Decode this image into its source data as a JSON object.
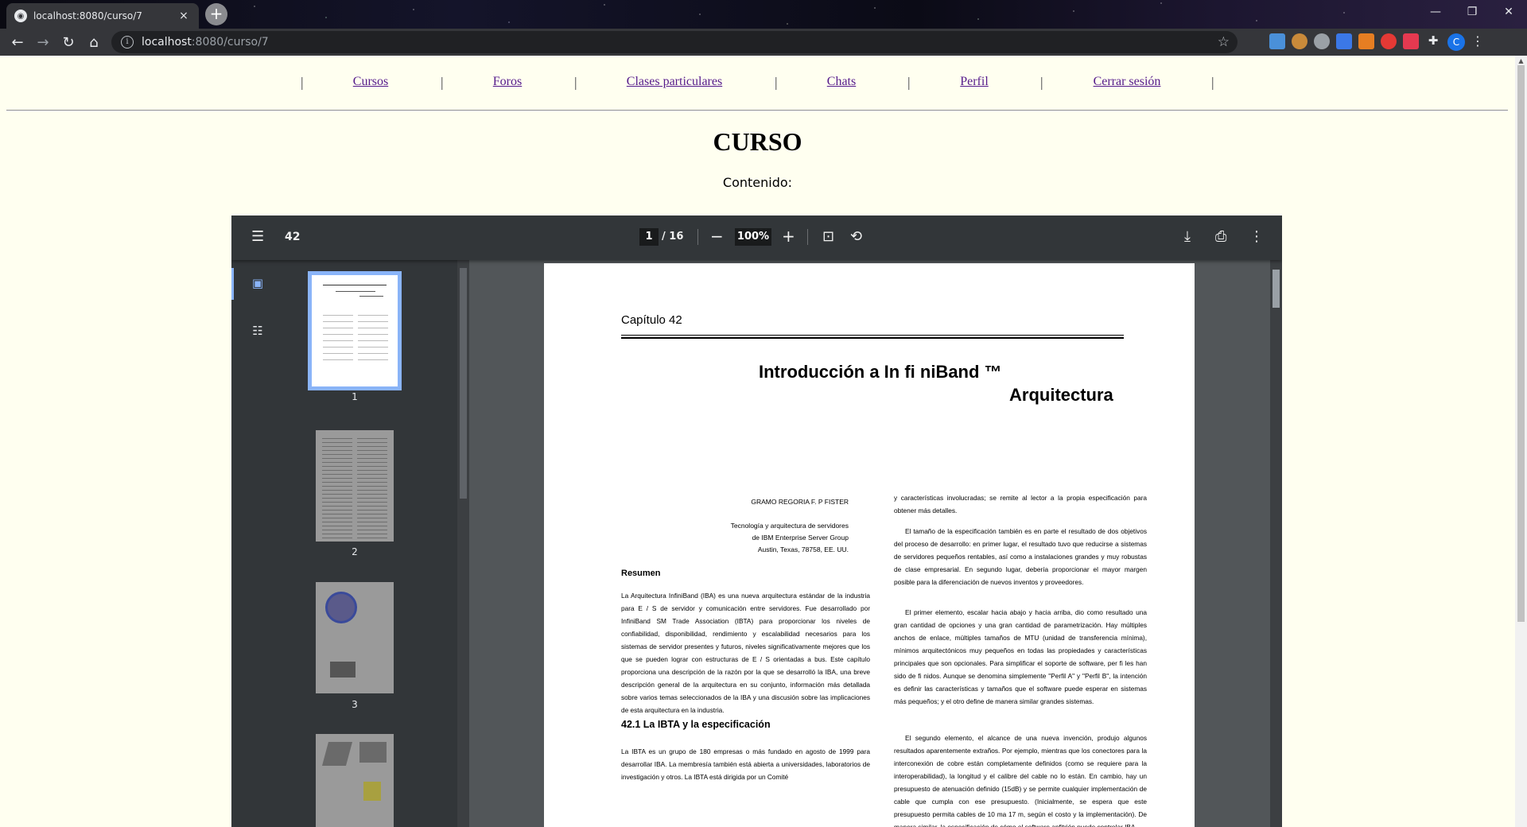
{
  "browser": {
    "tab_title": "localhost:8080/curso/7",
    "tab_close": "×",
    "new_tab": "+",
    "url_host": "localhost",
    "url_path": ":8080/curso/7",
    "profile_initial": "C"
  },
  "site_nav": {
    "links": [
      "Cursos",
      "Foros",
      "Clases particulares",
      "Chats",
      "Perfil",
      "Cerrar sesión"
    ],
    "separator": "|"
  },
  "page": {
    "title": "CURSO",
    "content_label": "Contenido:"
  },
  "pdf_viewer": {
    "doc_title": "42",
    "current_page": "1",
    "total_pages": "/ 16",
    "zoom": "100%",
    "thumbnails": [
      "1",
      "2",
      "3"
    ]
  },
  "pdf_page": {
    "chapter_label": "Capítulo 42",
    "title_line1": "Introducción a In fi niBand ™",
    "title_line2": "Arquitectura",
    "author_line1": "GRAMO REGORIA F. P FISTER",
    "author_line2": "Tecnología y arquitectura de servidores",
    "author_line3": "de IBM Enterprise Server Group",
    "author_line4": "Austin, Texas, 78758, EE. UU.",
    "resumen_heading": "Resumen",
    "resumen_text": "La Arquitectura InfiniBand (IBA) es una nueva arquitectura estándar de la industria para E / S de servidor y comunicación entre servidores. Fue desarrollado por InfiniBand SM Trade Association (IBTA) para proporcionar los niveles de confiabilidad, disponibilidad, rendimiento y escalabilidad necesarios para los sistemas de servidor presentes y futuros, niveles significativamente mejores que los que se pueden lograr con estructuras de E / S orientadas a bus. Este capítulo proporciona una descripción de la razón por la que se desarrolló la IBA, una breve descripción general de la arquitectura en su conjunto, información más detallada sobre varios temas seleccionados de la IBA y una discusión sobre las implicaciones de esta arquitectura en la industria.",
    "section_heading": "42.1 La IBTA y la especificación",
    "section_text": "La IBTA es un grupo de 180 empresas o más fundado en agosto de 1999 para desarrollar IBA. La membresía también está abierta a universidades, laboratorios de investigación y otros. La IBTA está dirigida por un Comité",
    "right_p1": "y características involucradas; se remite al lector a la propia especificación para obtener más detalles.",
    "right_p2": "El tamaño de la especificación también es en parte el resultado de dos objetivos del proceso de desarrollo: en primer lugar, el resultado tuvo que reducirse a sistemas de servidores pequeños rentables, así como a instalaciones grandes y muy robustas de clase empresarial. En segundo lugar, debería proporcionar el mayor margen posible para la diferenciación de nuevos inventos y proveedores.",
    "right_p3": "El primer elemento, escalar hacia abajo y hacia arriba, dio como resultado una gran cantidad de opciones y una gran cantidad de parametrización. Hay múltiples anchos de enlace, múltiples tamaños de MTU (unidad de transferencia mínima), mínimos arquitectónicos muy pequeños en todas las propiedades y características principales que son opcionales. Para simplificar el soporte de software, per fi les han sido de fi nidos. Aunque se denomina simplemente \"Perfil A\" y \"Perfil B\", la intención es definir las características y tamaños que el software puede esperar en sistemas más pequeños; y el otro define de manera similar grandes sistemas.",
    "right_p4": "El segundo elemento, el alcance de una nueva invención, produjo algunos resultados aparentemente extraños. Por ejemplo, mientras que los conectores para la interconexión de cobre están completamente definidos (como se requiere para la interoperabilidad), la longitud y el calibre del cable no lo están. En cambio, hay un presupuesto de atenuación definido (15dB) y se permite cualquier implementación de cable que cumpla con ese presupuesto. (Inicialmente, se espera que este presupuesto permita cables de 10 ma 17 m, según el costo y la implementación). De manera similar, la especificación de cómo el software anfitrión puede controlar IBA"
  },
  "colors": {
    "page_bg": "#fffff0",
    "link": "#551a8b",
    "pdf_toolbar": "#323639",
    "pdf_bg": "#525659",
    "selection": "#8ab4f8"
  }
}
